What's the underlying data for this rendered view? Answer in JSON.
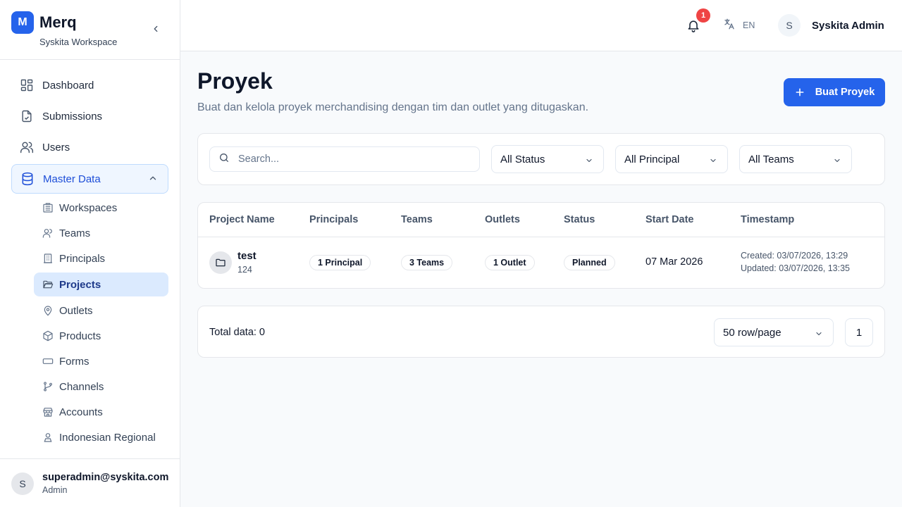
{
  "brand": {
    "logo_letter": "M",
    "name": "Merq",
    "workspace": "Syskita Workspace"
  },
  "sidebar": {
    "items": [
      {
        "label": "Dashboard",
        "icon": "dashboard-icon"
      },
      {
        "label": "Submissions",
        "icon": "file-check-icon"
      },
      {
        "label": "Users",
        "icon": "users-icon"
      },
      {
        "label": "Master Data",
        "icon": "database-icon",
        "expanded": true
      }
    ],
    "master_data_items": [
      {
        "label": "Workspaces",
        "icon": "building-icon"
      },
      {
        "label": "Teams",
        "icon": "users-icon"
      },
      {
        "label": "Principals",
        "icon": "office-building-icon"
      },
      {
        "label": "Projects",
        "icon": "folder-open-icon",
        "active": true
      },
      {
        "label": "Outlets",
        "icon": "map-pin-icon"
      },
      {
        "label": "Products",
        "icon": "box-icon"
      },
      {
        "label": "Forms",
        "icon": "form-input-icon"
      },
      {
        "label": "Channels",
        "icon": "git-branch-icon"
      },
      {
        "label": "Accounts",
        "icon": "store-icon"
      },
      {
        "label": "Indonesian Regional",
        "icon": "map-person-icon"
      }
    ],
    "footer": {
      "avatar": "S",
      "email": "superadmin@syskita.com",
      "role": "Admin"
    }
  },
  "header": {
    "notification_count": "1",
    "language": "EN",
    "user_avatar": "S",
    "user_name": "Syskita Admin"
  },
  "page": {
    "title": "Proyek",
    "subtitle": "Buat dan kelola proyek merchandising dengan tim dan outlet yang ditugaskan.",
    "create_button": "Buat Proyek"
  },
  "filters": {
    "search_placeholder": "Search...",
    "status": "All Status",
    "principal": "All Principal",
    "teams": "All Teams"
  },
  "table": {
    "columns": [
      "Project Name",
      "Principals",
      "Teams",
      "Outlets",
      "Status",
      "Start Date",
      "Timestamp"
    ],
    "rows": [
      {
        "name": "test",
        "code": "124",
        "principals": "1 Principal",
        "teams": "3 Teams",
        "outlets": "1 Outlet",
        "status": "Planned",
        "start_date": "07 Mar 2026",
        "created": "Created: 03/07/2026, 13:29",
        "updated": "Updated: 03/07/2026, 13:35"
      }
    ]
  },
  "pagination": {
    "total": "Total data: 0",
    "rows_per_page": "50 row/page",
    "current_page": "1"
  },
  "colors": {
    "primary": "#2563eb",
    "danger": "#ef4444",
    "active_bg": "#dbeafe"
  }
}
